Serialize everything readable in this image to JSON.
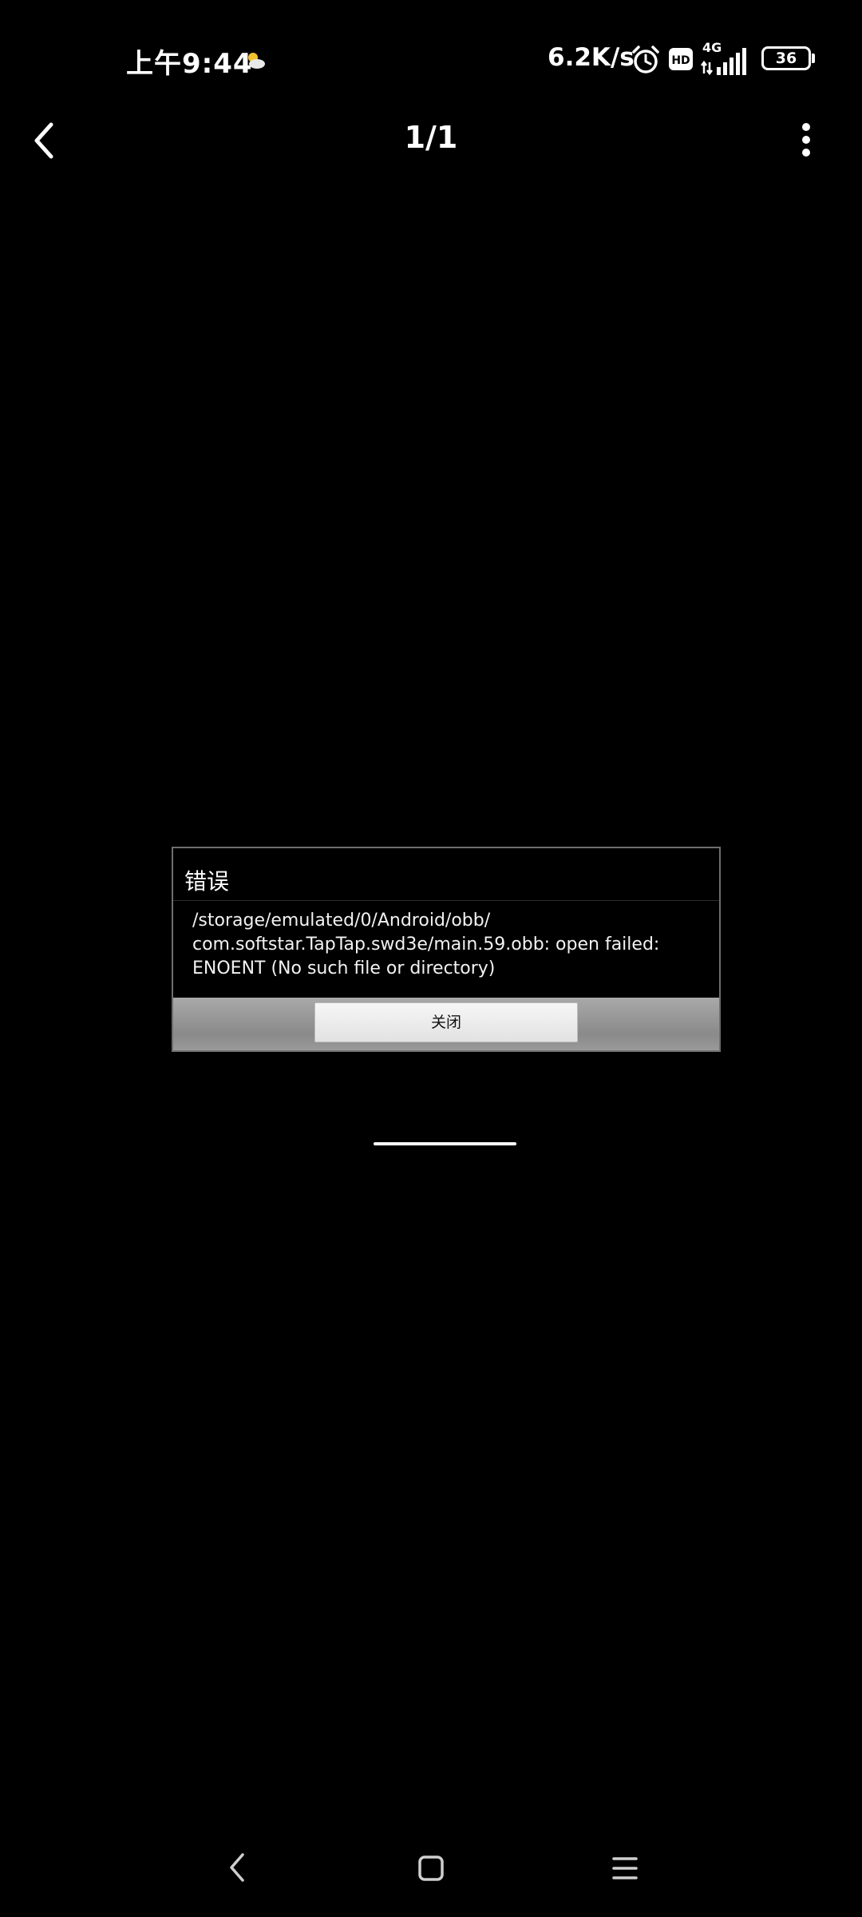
{
  "status_bar": {
    "time": "上午9:44",
    "net_speed": "6.2K/s",
    "network_type": "4G",
    "battery_level": "36",
    "icons": [
      "weather-icon",
      "alarm-icon",
      "hd-icon",
      "signal-icon",
      "battery-icon"
    ]
  },
  "top_bar": {
    "page_counter": "1/1",
    "icons": [
      "back-arrow-icon",
      "more-vertical-icon"
    ]
  },
  "dialog": {
    "title": "错误",
    "message_lines": [
      "/storage/emulated/0/Android/obb/",
      "com.softstar.TapTap.swd3e/main.59.obb: open failed:",
      "ENOENT (No such file or directory)"
    ],
    "close_label": "关闭"
  },
  "nav_bar": {
    "icons": [
      "nav-back-icon",
      "nav-home-icon",
      "nav-menu-icon"
    ]
  },
  "colors": {
    "background": "#000000",
    "text": "#ffffff",
    "dialog_border": "#6e6e6e",
    "dialog_footer": "#9a9a9a",
    "button_face": "#eeeeee"
  }
}
